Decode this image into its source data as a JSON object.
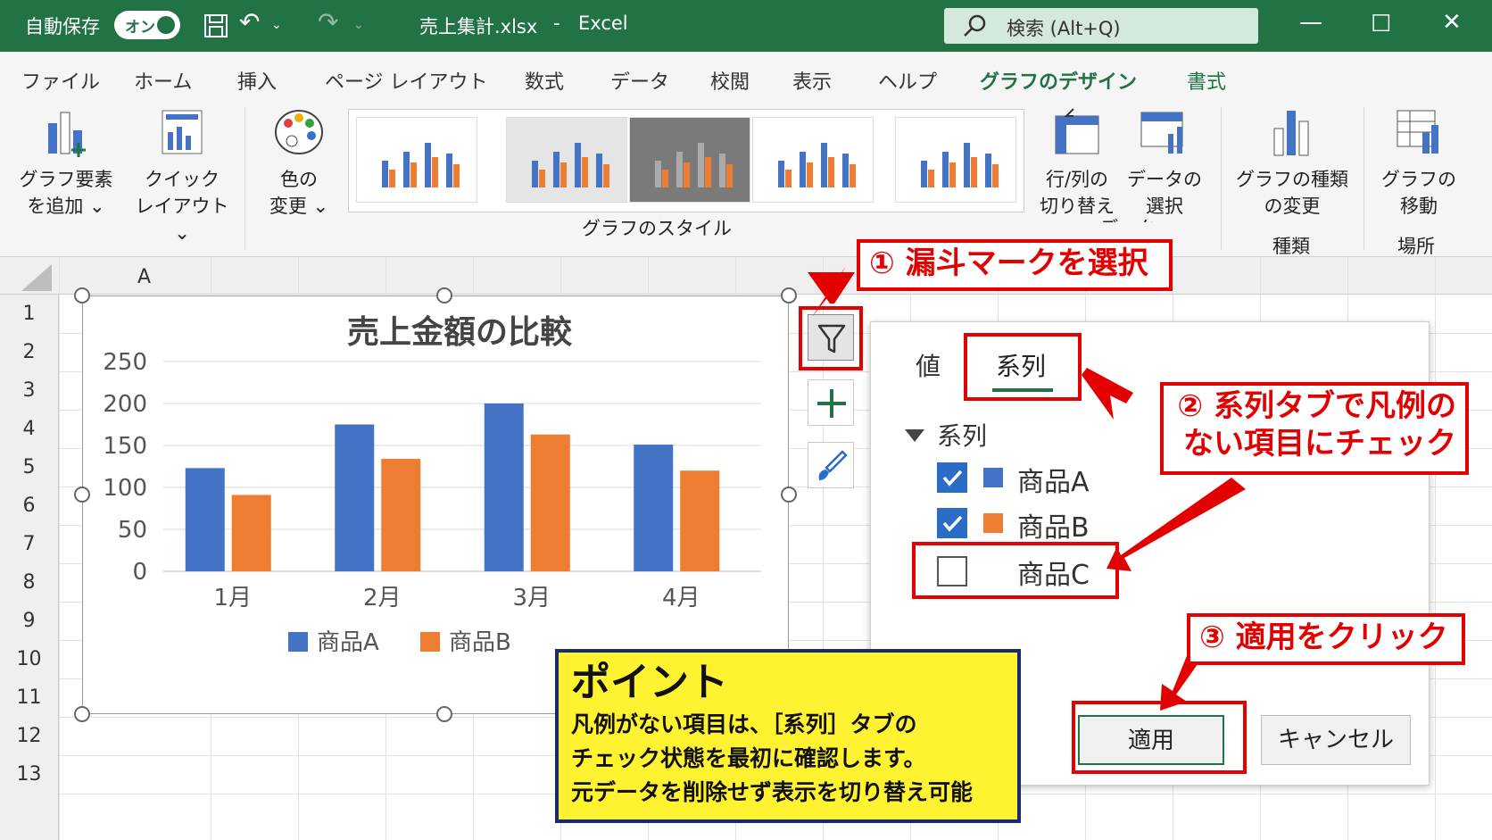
{
  "titlebar": {
    "autosave_label": "自動保存",
    "autosave_state": "オン",
    "filename": "売上集計.xlsx",
    "separator": "-",
    "app": "Excel",
    "search_placeholder": "検索 (Alt+Q)"
  },
  "tabs": [
    "ファイル",
    "ホーム",
    "挿入",
    "ページ レイアウト",
    "数式",
    "データ",
    "校閲",
    "表示",
    "ヘルプ",
    "グラフのデザイン",
    "書式"
  ],
  "ribbon": {
    "add_element": [
      "グラフ要素",
      "を追加 ⌄"
    ],
    "quick_layout": [
      "クイック",
      "レイアウト⌄"
    ],
    "change_color": [
      "色の",
      "変更 ⌄"
    ],
    "styles_group": "グラフのスタイル",
    "switch_rowcol": [
      "行/列の",
      "切り替え"
    ],
    "select_data": [
      "データの",
      "選択"
    ],
    "data_group": "データ",
    "change_type": [
      "グラフの種類",
      "の変更"
    ],
    "type_group": "種類",
    "move_chart": [
      "グラフの",
      "移動"
    ],
    "location_group": "場所"
  },
  "sheet": {
    "column_a": "A",
    "rows": [
      "1",
      "2",
      "3",
      "4",
      "5",
      "6",
      "7",
      "8",
      "9",
      "10",
      "11",
      "12",
      "13"
    ]
  },
  "chart_data": {
    "type": "bar",
    "title": "売上金額の比較",
    "categories": [
      "1月",
      "2月",
      "3月",
      "4月"
    ],
    "series": [
      {
        "name": "商品A",
        "values": [
          123,
          175,
          200,
          151
        ],
        "color": "#4472c4"
      },
      {
        "name": "商品B",
        "values": [
          91,
          134,
          163,
          120
        ],
        "color": "#ed7d31"
      }
    ],
    "yticks": [
      "0",
      "50",
      "100",
      "150",
      "200",
      "250"
    ],
    "ylim": [
      0,
      250
    ],
    "legend": "bottom"
  },
  "filter_panel": {
    "tab_values": "値",
    "tab_series": "系列",
    "section": "系列",
    "items": [
      {
        "label": "商品A",
        "checked": true,
        "color": "#4472c4"
      },
      {
        "label": "商品B",
        "checked": true,
        "color": "#ed7d31"
      },
      {
        "label": "商品C",
        "checked": false
      }
    ],
    "apply": "適用",
    "cancel": "キャンセル"
  },
  "callouts": {
    "step1": "① 漏斗マークを選択",
    "step2": [
      "② 系列タブで凡例の",
      "ない項目にチェック"
    ],
    "step3": "③ 適用をクリック"
  },
  "point": {
    "heading": "ポイント",
    "lines": [
      "凡例がない項目は、［系列］タブの",
      "チェック状態を最初に確認します。",
      "元データを削除せず表示を切り替え可能"
    ]
  },
  "colors": {
    "excel_green": "#217346",
    "callout_red": "#e30000",
    "point_yellow": "#fff230"
  }
}
